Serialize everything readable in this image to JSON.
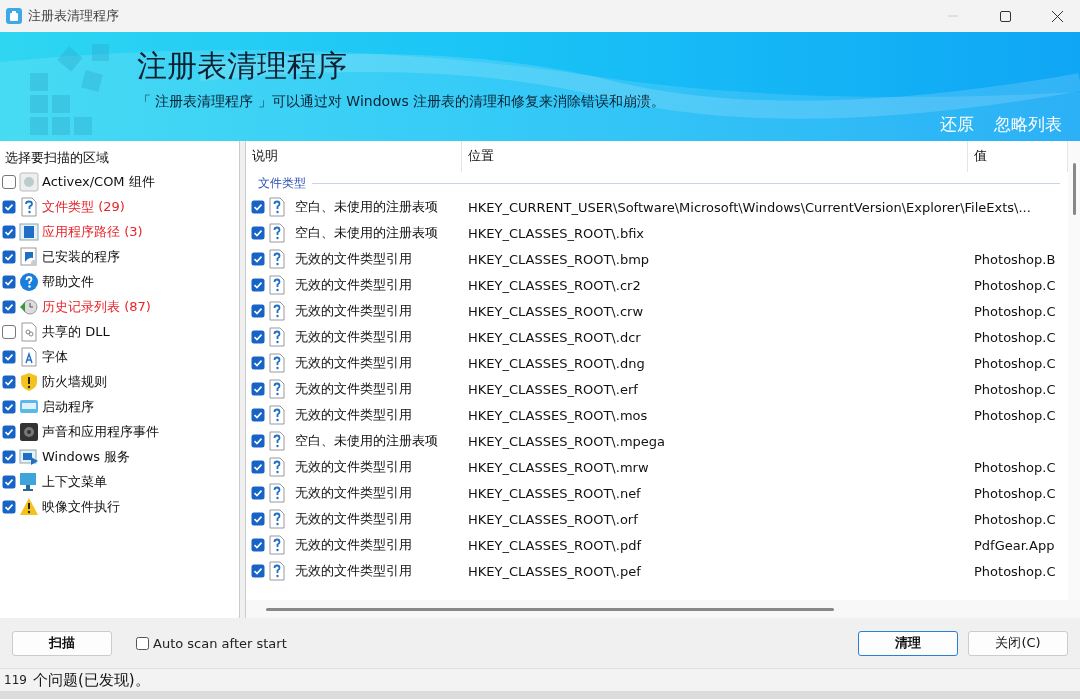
{
  "window": {
    "title": "注册表清理程序"
  },
  "banner": {
    "title": "注册表清理程序",
    "subtitle": "「 注册表清理程序 」可以通过对 Windows 注册表的清理和修复来消除错误和崩溃。",
    "links": [
      "还原",
      "忽略列表"
    ]
  },
  "sidebar": {
    "heading": "选择要扫描的区域",
    "items": [
      {
        "kind": "activex",
        "label": "Activex/COM 组件",
        "checked": false,
        "found": false
      },
      {
        "kind": "filetype",
        "label": "文件类型",
        "count": "(29)",
        "checked": true,
        "found": true
      },
      {
        "kind": "apppath",
        "label": "应用程序路径",
        "count": "(3)",
        "checked": true,
        "found": true
      },
      {
        "kind": "installed",
        "label": "已安装的程序",
        "checked": true,
        "found": false
      },
      {
        "kind": "help",
        "label": "帮助文件",
        "checked": true,
        "found": false
      },
      {
        "kind": "history",
        "label": "历史记录列表",
        "count": "(87)",
        "checked": true,
        "found": true
      },
      {
        "kind": "dll",
        "label": "共享的 DLL",
        "checked": false,
        "found": false
      },
      {
        "kind": "font",
        "label": "字体",
        "checked": true,
        "found": false
      },
      {
        "kind": "firewall",
        "label": "防火墙规则",
        "checked": true,
        "found": false
      },
      {
        "kind": "startup",
        "label": "启动程序",
        "checked": true,
        "found": false
      },
      {
        "kind": "sound",
        "label": "声音和应用程序事件",
        "checked": true,
        "found": false
      },
      {
        "kind": "service",
        "label": "Windows 服务",
        "checked": true,
        "found": false
      },
      {
        "kind": "contextmenu",
        "label": "上下文菜单",
        "checked": true,
        "found": false
      },
      {
        "kind": "imageexec",
        "label": "映像文件执行",
        "checked": true,
        "found": false
      }
    ]
  },
  "table": {
    "columns": [
      "说明",
      "位置",
      "值"
    ],
    "group": "文件类型",
    "rows": [
      {
        "checked": true,
        "description": "空白、未使用的注册表项",
        "location": "HKEY_CURRENT_USER\\Software\\Microsoft\\Windows\\CurrentVersion\\Explorer\\FileExts\\..."
      },
      {
        "checked": true,
        "description": "空白、未使用的注册表项",
        "location": "HKEY_CLASSES_ROOT\\.bfix"
      },
      {
        "checked": true,
        "description": "无效的文件类型引用",
        "location": "HKEY_CLASSES_ROOT\\.bmp",
        "value": "Photoshop.B"
      },
      {
        "checked": true,
        "description": "无效的文件类型引用",
        "location": "HKEY_CLASSES_ROOT\\.cr2",
        "value": "Photoshop.C"
      },
      {
        "checked": true,
        "description": "无效的文件类型引用",
        "location": "HKEY_CLASSES_ROOT\\.crw",
        "value": "Photoshop.C"
      },
      {
        "checked": true,
        "description": "无效的文件类型引用",
        "location": "HKEY_CLASSES_ROOT\\.dcr",
        "value": "Photoshop.C"
      },
      {
        "checked": true,
        "description": "无效的文件类型引用",
        "location": "HKEY_CLASSES_ROOT\\.dng",
        "value": "Photoshop.C"
      },
      {
        "checked": true,
        "description": "无效的文件类型引用",
        "location": "HKEY_CLASSES_ROOT\\.erf",
        "value": "Photoshop.C"
      },
      {
        "checked": true,
        "description": "无效的文件类型引用",
        "location": "HKEY_CLASSES_ROOT\\.mos",
        "value": "Photoshop.C"
      },
      {
        "checked": true,
        "description": "空白、未使用的注册表项",
        "location": "HKEY_CLASSES_ROOT\\.mpega"
      },
      {
        "checked": true,
        "description": "无效的文件类型引用",
        "location": "HKEY_CLASSES_ROOT\\.mrw",
        "value": "Photoshop.C"
      },
      {
        "checked": true,
        "description": "无效的文件类型引用",
        "location": "HKEY_CLASSES_ROOT\\.nef",
        "value": "Photoshop.C"
      },
      {
        "checked": true,
        "description": "无效的文件类型引用",
        "location": "HKEY_CLASSES_ROOT\\.orf",
        "value": "Photoshop.C"
      },
      {
        "checked": true,
        "description": "无效的文件类型引用",
        "location": "HKEY_CLASSES_ROOT\\.pdf",
        "value": "PdfGear.App"
      },
      {
        "checked": true,
        "description": "无效的文件类型引用",
        "location": "HKEY_CLASSES_ROOT\\.pef",
        "value": "Photoshop.C"
      }
    ]
  },
  "footer": {
    "scan_button": "扫描",
    "auto_scan": {
      "label": "Auto scan after start",
      "checked": false
    },
    "clean_button": "清理",
    "close_button": "关闭(C)"
  },
  "status_bar": {
    "count": "119",
    "text": "个问题(已发现)。"
  }
}
